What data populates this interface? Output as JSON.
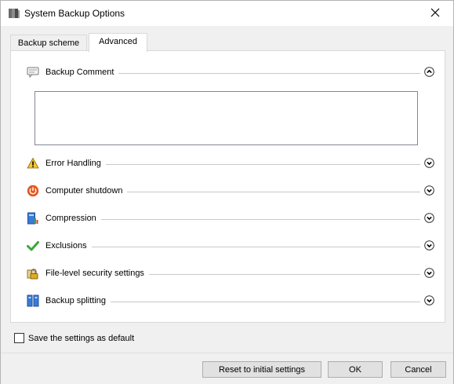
{
  "window": {
    "title": "System Backup Options"
  },
  "tabs": [
    {
      "label": "Backup scheme",
      "active": false
    },
    {
      "label": "Advanced",
      "active": true
    }
  ],
  "sections": [
    {
      "label": "Backup Comment",
      "icon": "comment-icon",
      "state": "expanded"
    },
    {
      "label": "Error Handling",
      "icon": "warning-icon",
      "state": "collapsed"
    },
    {
      "label": "Computer shutdown",
      "icon": "power-icon",
      "state": "collapsed"
    },
    {
      "label": "Compression",
      "icon": "compression-icon",
      "state": "collapsed"
    },
    {
      "label": "Exclusions",
      "icon": "checkmark-icon",
      "state": "collapsed"
    },
    {
      "label": "File-level security settings",
      "icon": "lock-icon",
      "state": "collapsed"
    },
    {
      "label": "Backup splitting",
      "icon": "split-icon",
      "state": "collapsed"
    }
  ],
  "comment": {
    "value": ""
  },
  "default_checkbox": {
    "label": "Save the settings as default",
    "checked": false
  },
  "buttons": {
    "reset": "Reset to initial settings",
    "ok": "OK",
    "cancel": "Cancel"
  },
  "colors": {
    "accent_power": "#e8561c",
    "accent_check": "#3aa83a",
    "toggle_border": "#333333"
  }
}
